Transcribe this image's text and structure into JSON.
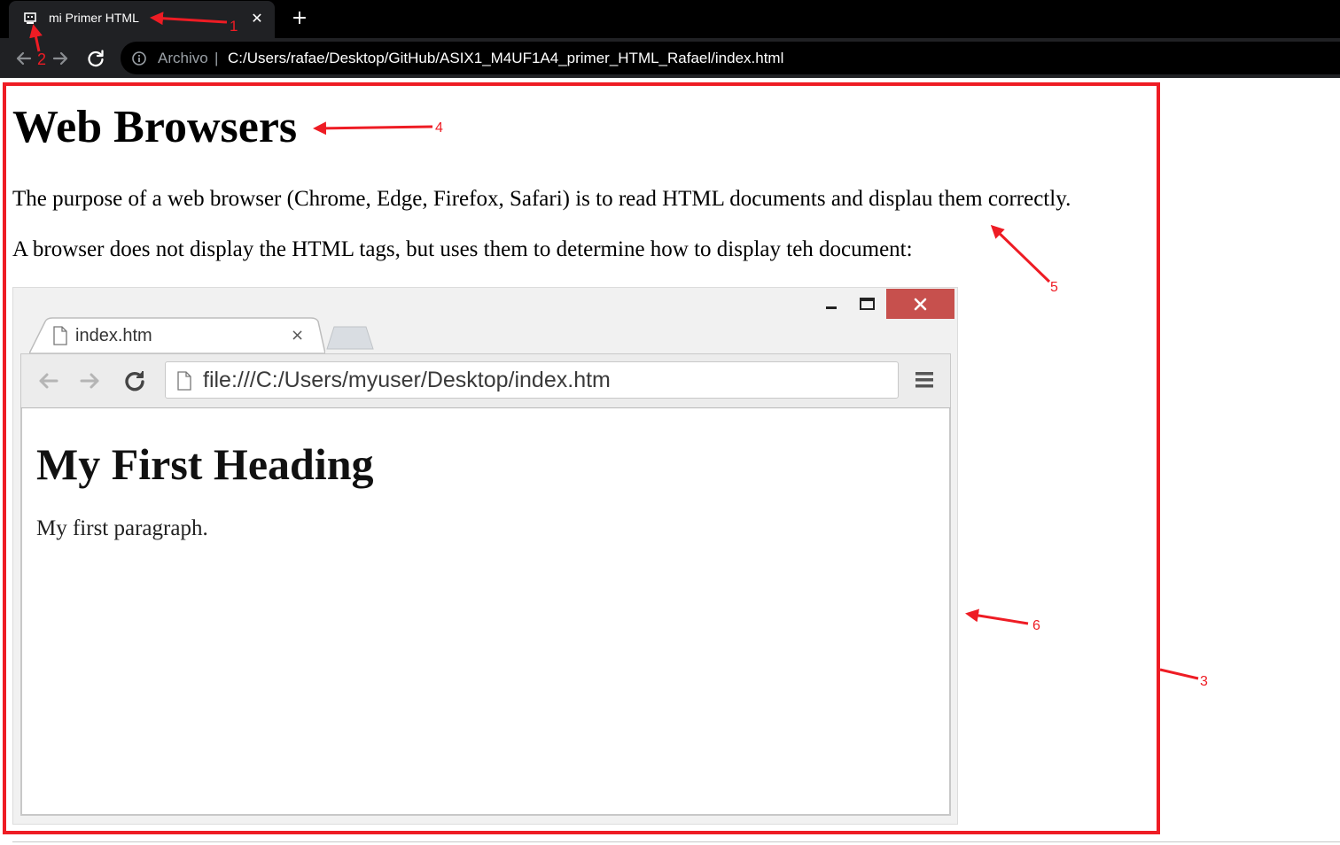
{
  "browser": {
    "tab": {
      "title": "mi Primer HTML",
      "favicon": "page-icon",
      "close_glyph": "✕"
    },
    "new_tab_glyph": "+",
    "toolbar": {
      "back": "back-arrow-icon",
      "forward": "forward-arrow-icon",
      "reload": "reload-icon"
    },
    "address": {
      "info_icon": "info-icon",
      "scheme_label": "Archivo",
      "separator": "|",
      "url": "C:/Users/rafae/Desktop/GitHub/ASIX1_M4UF1A4_primer_HTML_Rafael/index.html"
    }
  },
  "page": {
    "heading": "Web Browsers",
    "paragraphs": [
      "The purpose of a web browser (Chrome, Edge, Firefox, Safari) is to read HTML documents and displau them correctly.",
      "A browser does not display the HTML tags, but uses them to determine how to display teh document:"
    ],
    "embedded_screenshot": {
      "window_controls": [
        "minimize-icon",
        "maximize-icon",
        "close-icon"
      ],
      "tab_title": "index.htm",
      "tab_close_glyph": "×",
      "url": "file:///C:/Users/myuser/Desktop/index.htm",
      "heading": "My First Heading",
      "paragraph": "My first paragraph."
    }
  },
  "annotations": {
    "color": "#ee1c24",
    "labels": [
      "1",
      "2",
      "3",
      "4",
      "5",
      "6"
    ]
  },
  "colors": {
    "tabbar_bg": "#000000",
    "toolbar_bg": "#202124",
    "annotation_red": "#ee1c24",
    "window_close_red": "#c7504d"
  }
}
